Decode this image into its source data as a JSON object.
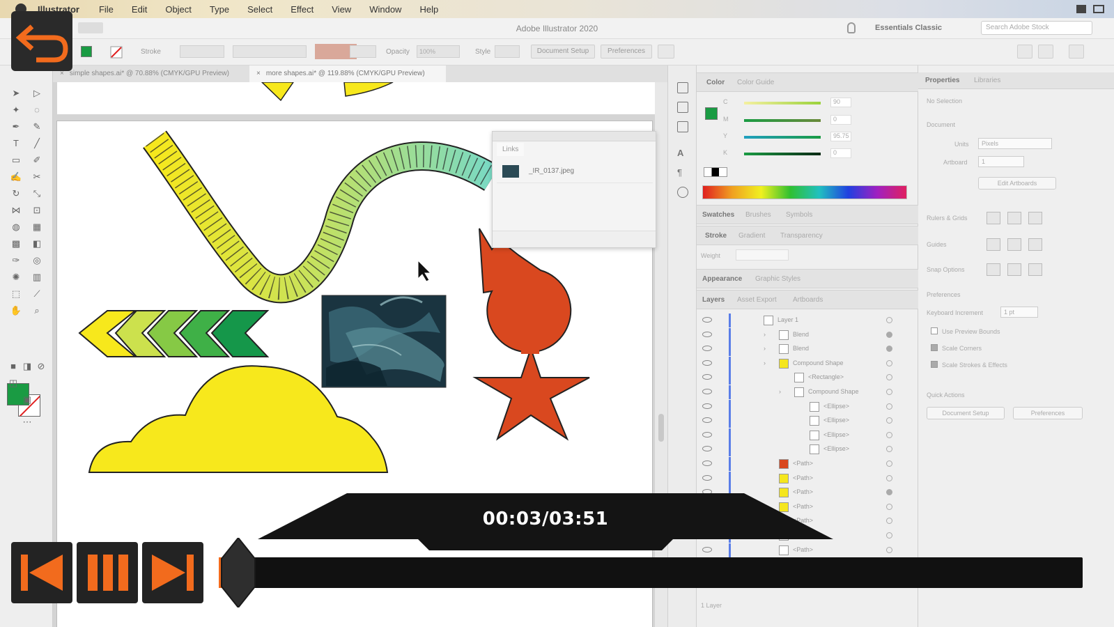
{
  "menubar": {
    "items": [
      "Illustrator",
      "File",
      "Edit",
      "Object",
      "Type",
      "Select",
      "Effect",
      "View",
      "Window",
      "Help"
    ]
  },
  "titlebar": {
    "title": "Adobe Illustrator 2020",
    "workspace": "Essentials Classic",
    "search_placeholder": "Search Adobe Stock"
  },
  "controlbar": {
    "stroke_label": "Stroke",
    "opacity_label": "Opacity",
    "opacity_value": "100%",
    "style_label": "Style",
    "document_setup": "Document Setup",
    "preferences": "Preferences"
  },
  "doc_tabs": [
    {
      "label": "simple shapes.ai* @ 70.88% (CMYK/GPU Preview)"
    },
    {
      "label": "more shapes.ai* @ 119.88% (CMYK/GPU Preview)"
    }
  ],
  "links_panel": {
    "tab": "Links",
    "file": "_IR_0137.jpeg"
  },
  "color_panel": {
    "tabs": [
      "Color",
      "Color Guide"
    ],
    "channels": [
      {
        "name": "C",
        "value": "90"
      },
      {
        "name": "M",
        "value": "0"
      },
      {
        "name": "Y",
        "value": "95.75"
      },
      {
        "name": "K",
        "value": "0"
      }
    ],
    "colors": {
      "c": "#9bd23c",
      "m": "#1a9b43",
      "y": "#1a9b43",
      "k": "#1a9b43"
    }
  },
  "panel_groups": {
    "swatches": [
      "Swatches",
      "Brushes",
      "Symbols"
    ],
    "stroke": [
      "Stroke",
      "Gradient",
      "Transparency"
    ],
    "stroke_weight_label": "Weight",
    "appearance": [
      "Appearance",
      "Graphic Styles"
    ],
    "layers": [
      "Layers",
      "Asset Export",
      "Artboards"
    ]
  },
  "layers": [
    {
      "indent": 0,
      "label": "Layer 1",
      "swatch": "#ffffff",
      "target": false
    },
    {
      "indent": 1,
      "label": "Blend",
      "swatch": "#ffffff",
      "target": true
    },
    {
      "indent": 1,
      "label": "Blend",
      "swatch": "#ffffff",
      "target": true
    },
    {
      "indent": 1,
      "label": "Compound Shape",
      "swatch": "#f5e61e",
      "target": false
    },
    {
      "indent": 2,
      "label": "<Rectangle>",
      "swatch": "#ffffff",
      "target": false
    },
    {
      "indent": 2,
      "label": "Compound Shape",
      "swatch": "#ffffff",
      "target": false
    },
    {
      "indent": 3,
      "label": "<Ellipse>",
      "swatch": "#ffffff",
      "target": false
    },
    {
      "indent": 3,
      "label": "<Ellipse>",
      "swatch": "#ffffff",
      "target": false
    },
    {
      "indent": 3,
      "label": "<Ellipse>",
      "swatch": "#ffffff",
      "target": false
    },
    {
      "indent": 3,
      "label": "<Ellipse>",
      "swatch": "#ffffff",
      "target": false
    },
    {
      "indent": 1,
      "label": "<Path>",
      "swatch": "#d9481f",
      "target": false
    },
    {
      "indent": 1,
      "label": "<Path>",
      "swatch": "#f5e61e",
      "target": false
    },
    {
      "indent": 1,
      "label": "<Path>",
      "swatch": "#f5e61e",
      "target": true
    },
    {
      "indent": 1,
      "label": "<Path>",
      "swatch": "#f5e61e",
      "target": false
    },
    {
      "indent": 1,
      "label": "<Path>",
      "swatch": "#ffffff",
      "target": false
    },
    {
      "indent": 1,
      "label": "<Path>",
      "swatch": "#ffffff",
      "target": false
    },
    {
      "indent": 1,
      "label": "<Path>",
      "swatch": "#ffffff",
      "target": false
    },
    {
      "indent": 1,
      "label": "<Path>",
      "swatch": "#ffffff",
      "target": false
    },
    {
      "indent": 1,
      "label": "<Path>",
      "swatch": "#ffffff",
      "target": false
    }
  ],
  "layers_footer": "1 Layer",
  "properties": {
    "tabs": [
      "Properties",
      "Libraries"
    ],
    "no_selection": "No Selection",
    "document": "Document",
    "units_label": "Units",
    "units_value": "Pixels",
    "artboard_label": "Artboard",
    "artboard_value": "1",
    "edit_artboards": "Edit Artboards",
    "rulers_grids": "Rulers & Grids",
    "guides": "Guides",
    "snap_options": "Snap Options",
    "preferences": "Preferences",
    "keyboard_increment": "Keyboard Increment",
    "keyboard_increment_value": "1 pt",
    "use_preview_bounds": "Use Preview Bounds",
    "scale_corners": "Scale Corners",
    "scale_strokes": "Scale Strokes & Effects",
    "quick_actions": "Quick Actions",
    "document_setup_btn": "Document Setup",
    "preferences_btn": "Preferences"
  },
  "player": {
    "time": "00:03/03:51",
    "progress": 0.013,
    "accent": "#f26b1d"
  }
}
